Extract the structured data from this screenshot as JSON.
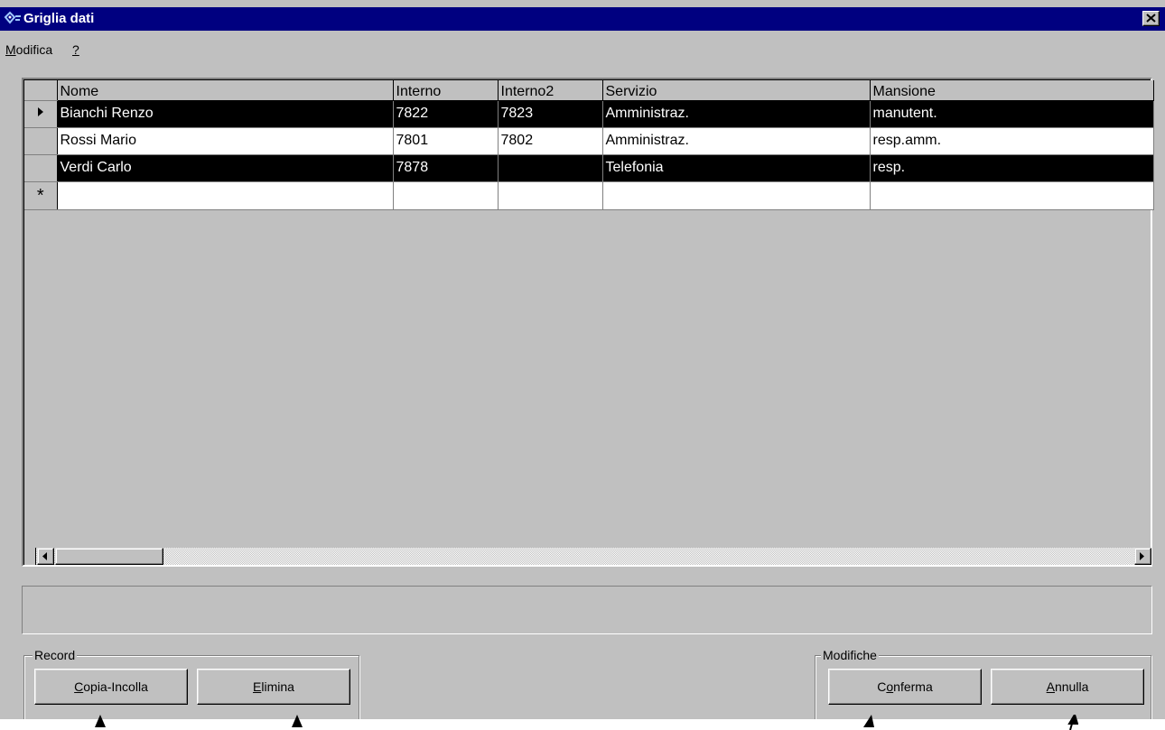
{
  "window": {
    "title": "Griglia dati"
  },
  "menu": {
    "items": [
      {
        "accel": "M",
        "rest": "odifica"
      },
      {
        "accel": "?",
        "rest": ""
      }
    ]
  },
  "grid": {
    "columns": [
      "Nome",
      "Interno",
      "Interno2",
      "Servizio",
      "Mansione"
    ],
    "rows": [
      {
        "indicator": "▶",
        "cells": [
          "Bianchi Renzo",
          "7822",
          "7823",
          "Amministraz.",
          "manutent."
        ]
      },
      {
        "indicator": "",
        "cells": [
          "Rossi Mario",
          "7801",
          "7802",
          "Amministraz.",
          "resp.amm."
        ]
      },
      {
        "indicator": "",
        "cells": [
          "Verdi Carlo",
          "7878",
          "",
          "Telefonia",
          "resp."
        ]
      }
    ],
    "new_row_indicator": "*"
  },
  "status": {
    "text": ""
  },
  "record_group": {
    "label": "Record",
    "copy_accel": "C",
    "copy_rest": "opia-Incolla",
    "delete_accel": "E",
    "delete_rest": "limina"
  },
  "changes_group": {
    "label": "Modifiche",
    "confirm_pre": "C",
    "confirm_accel": "o",
    "confirm_rest": "nferma",
    "cancel_accel": "A",
    "cancel_rest": "nnulla"
  },
  "colors": {
    "titlebar": "#000080",
    "face": "#c0c0c0",
    "selected_row": "#000000"
  }
}
